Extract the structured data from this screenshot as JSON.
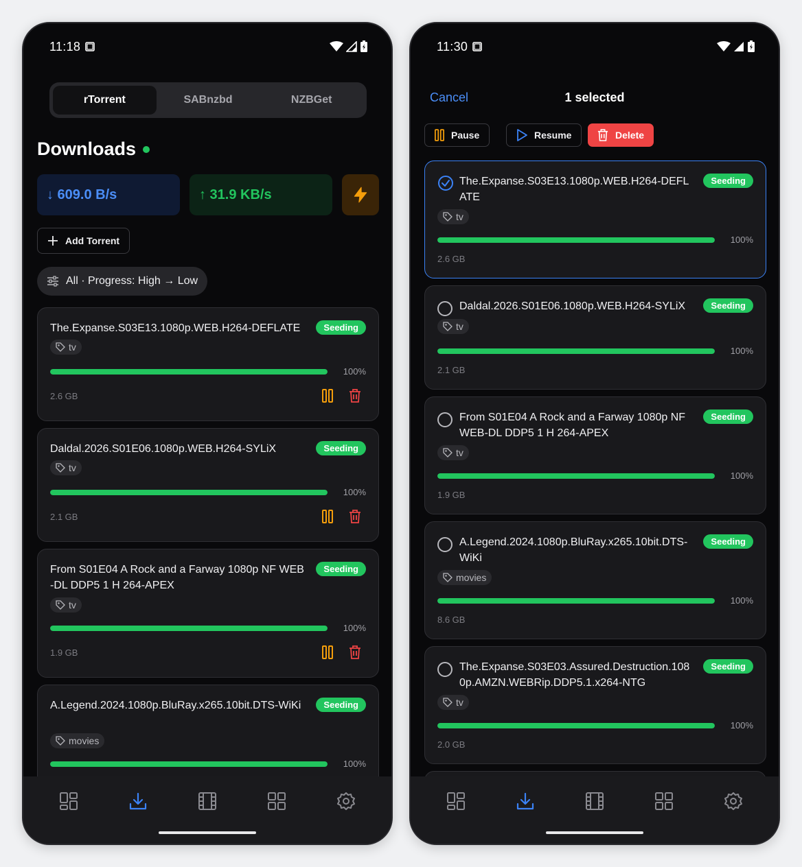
{
  "left": {
    "status": {
      "time": "11:18"
    },
    "tabs": [
      {
        "label": "rTorrent",
        "active": true
      },
      {
        "label": "SABnzbd",
        "active": false
      },
      {
        "label": "NZBGet",
        "active": false
      }
    ],
    "title": "Downloads",
    "download_speed": "↓ 609.0 B/s",
    "upload_speed": "↑ 31.9 KB/s",
    "add_label": "Add Torrent",
    "filter_label": "All · Progress: High → Low",
    "torrents": [
      {
        "name": "The.Expanse.S03E13.1080p.WEB.H264-DEFLATE",
        "status": "Seeding",
        "tag": "tv",
        "progress": "100%",
        "size": "2.6 GB"
      },
      {
        "name": "Daldal.2026.S01E06.1080p.WEB.H264-SYLiX",
        "status": "Seeding",
        "tag": "tv",
        "progress": "100%",
        "size": "2.1 GB"
      },
      {
        "name": "From S01E04 A Rock and a Farway 1080p NF WEB-DL DDP5 1 H 264-APEX",
        "status": "Seeding",
        "tag": "tv",
        "progress": "100%",
        "size": "1.9 GB"
      },
      {
        "name": "A.Legend.2024.1080p.BluRay.x265.10bit.DTS-WiKi",
        "status": "Seeding",
        "tag": "movies",
        "progress": "100%",
        "size": ""
      }
    ]
  },
  "right": {
    "status": {
      "time": "11:30"
    },
    "cancel_label": "Cancel",
    "selected_label": "1 selected",
    "actions": {
      "pause": "Pause",
      "resume": "Resume",
      "delete": "Delete"
    },
    "torrents": [
      {
        "name": "The.Expanse.S03E13.1080p.WEB.H264-DEFLATE",
        "status": "Seeding",
        "tag": "tv",
        "progress": "100%",
        "size": "2.6 GB",
        "selected": true
      },
      {
        "name": "Daldal.2026.S01E06.1080p.WEB.H264-SYLiX",
        "status": "Seeding",
        "tag": "tv",
        "progress": "100%",
        "size": "2.1 GB",
        "selected": false
      },
      {
        "name": "From S01E04 A Rock and a Farway 1080p NF WEB-DL DDP5 1 H 264-APEX",
        "status": "Seeding",
        "tag": "tv",
        "progress": "100%",
        "size": "1.9 GB",
        "selected": false
      },
      {
        "name": "A.Legend.2024.1080p.BluRay.x265.10bit.DTS-WiKi",
        "status": "Seeding",
        "tag": "movies",
        "progress": "100%",
        "size": "8.6 GB",
        "selected": false
      },
      {
        "name": "The.Expanse.S03E03.Assured.Destruction.1080p.AMZN.WEBRip.DDP5.1.x264-NTG",
        "status": "Seeding",
        "tag": "tv",
        "progress": "100%",
        "size": "2.0 GB",
        "selected": false
      }
    ]
  },
  "nav_items": [
    "dashboard-icon",
    "download-icon",
    "film-icon",
    "grid-icon",
    "settings-icon"
  ],
  "colors": {
    "accent": "#3b82f6",
    "seeding": "#22c55e",
    "danger": "#ef4444",
    "warning": "#f59e0b"
  }
}
